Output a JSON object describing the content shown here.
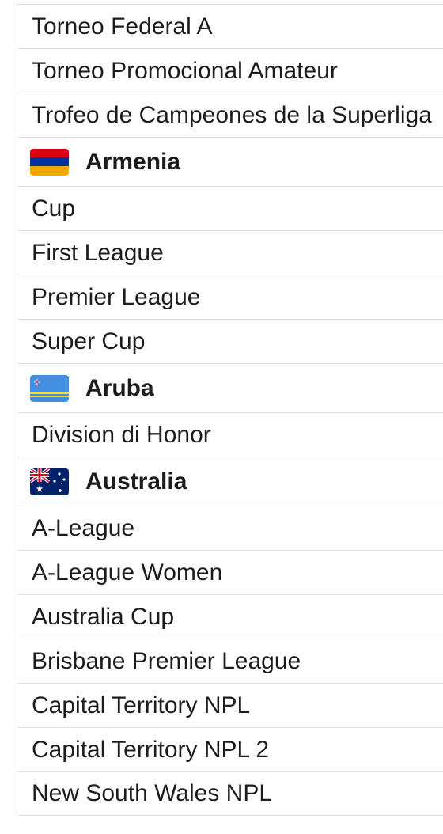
{
  "groups": [
    {
      "country": "",
      "leagues": [
        "Torneo Federal A",
        "Torneo Promocional Amateur",
        "Trofeo de Campeones de la Superliga"
      ]
    },
    {
      "country": "Armenia",
      "flag_icon": "armenia-flag-icon",
      "flag_colors": [
        "#d90012",
        "#0033a0",
        "#f2a800"
      ],
      "leagues": [
        "Cup",
        "First League",
        "Premier League",
        "Super Cup"
      ]
    },
    {
      "country": "Aruba",
      "flag_icon": "aruba-flag-icon",
      "flag_colors": [
        "#418fde",
        "#fbe122",
        "#ffffff",
        "#ef3340"
      ],
      "leagues": [
        "Division di Honor"
      ]
    },
    {
      "country": "Australia",
      "flag_icon": "australia-flag-icon",
      "flag_colors": [
        "#012169",
        "#ffffff",
        "#e4002b"
      ],
      "leagues": [
        "A-League",
        "A-League Women",
        "Australia Cup",
        "Brisbane Premier League",
        "Capital Territory NPL",
        "Capital Territory NPL 2",
        "New South Wales NPL"
      ]
    }
  ]
}
